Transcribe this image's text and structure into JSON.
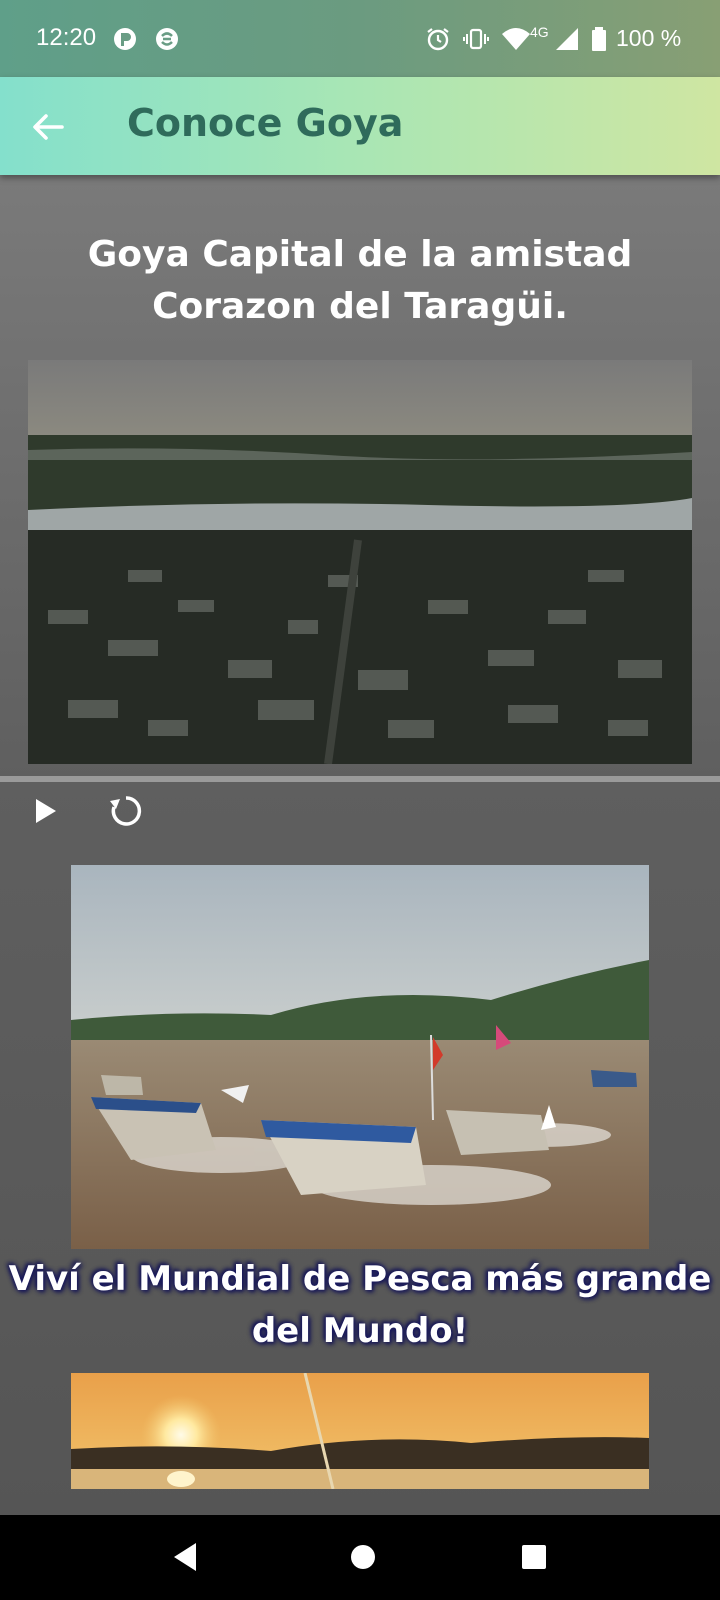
{
  "status_bar": {
    "time": "12:20",
    "network": "4G",
    "battery": "100 %",
    "icons": [
      "app-icon-1",
      "app-icon-2",
      "alarm-icon",
      "vibrate-icon",
      "wifi-icon",
      "signal-icon",
      "battery-icon"
    ]
  },
  "app_bar": {
    "title": "Conoce Goya",
    "back_icon": "arrow-left-icon",
    "colors": {
      "gradient_start": "#84e0cc",
      "gradient_end": "#cfe6a2",
      "title": "#2f6b5b"
    }
  },
  "content": {
    "headline": "Goya Capital de la amistad Corazon del Taragüi.",
    "slideshow_controls": {
      "play_icon": "play-icon",
      "replay_icon": "replay-icon"
    },
    "caption": "Viví el Mundial de Pesca más grande del Mundo!"
  },
  "nav_bar": {
    "icons": [
      "back-triangle-icon",
      "home-circle-icon",
      "recents-square-icon"
    ]
  }
}
